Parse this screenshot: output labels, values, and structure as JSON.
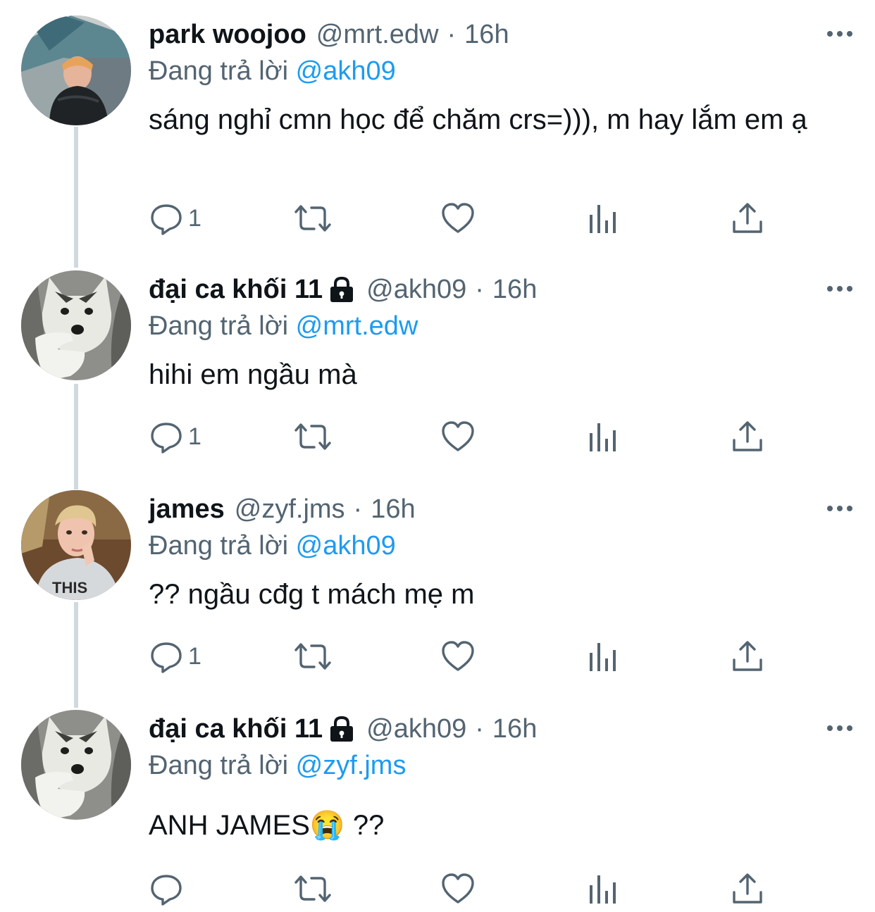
{
  "colors": {
    "text": "#0f1419",
    "secondary": "#536471",
    "mention": "#1d9bf0",
    "thread_line": "#cfd9de"
  },
  "tweets": [
    {
      "name": "park woojoo",
      "locked": false,
      "handle": "@mrt.edw",
      "time": "16h",
      "replying_label": "Đang trả lời",
      "replying_to": "@akh09",
      "text": "sáng nghỉ cmn học để chăm crs=))), m hay lắm em ạ",
      "reply_count": "1",
      "avatar": "avatar-photo-boy-jacket"
    },
    {
      "name": "đại ca khối 11",
      "locked": true,
      "handle": "@akh09",
      "time": "16h",
      "replying_label": "Đang trả lời",
      "replying_to": "@mrt.edw",
      "text": "hihi em ngầu mà",
      "reply_count": "1",
      "avatar": "avatar-husky-pointing"
    },
    {
      "name": "james",
      "locked": false,
      "handle": "@zyf.jms",
      "time": "16h",
      "replying_label": "Đang trả lời",
      "replying_to": "@akh09",
      "text": "?? ngầu cđg t mách mẹ m",
      "reply_count": "1",
      "avatar": "avatar-photo-blond-man"
    },
    {
      "name": "đại ca khối 11",
      "locked": true,
      "handle": "@akh09",
      "time": "16h",
      "replying_label": "Đang trả lời",
      "replying_to": "@zyf.jms",
      "text": "ANH JAMES😭 ??",
      "reply_count": "",
      "avatar": "avatar-husky-pointing"
    }
  ],
  "separator": "·",
  "icons": [
    "reply-icon",
    "retweet-icon",
    "like-icon",
    "analytics-icon",
    "share-icon",
    "more-icon",
    "lock-icon"
  ]
}
